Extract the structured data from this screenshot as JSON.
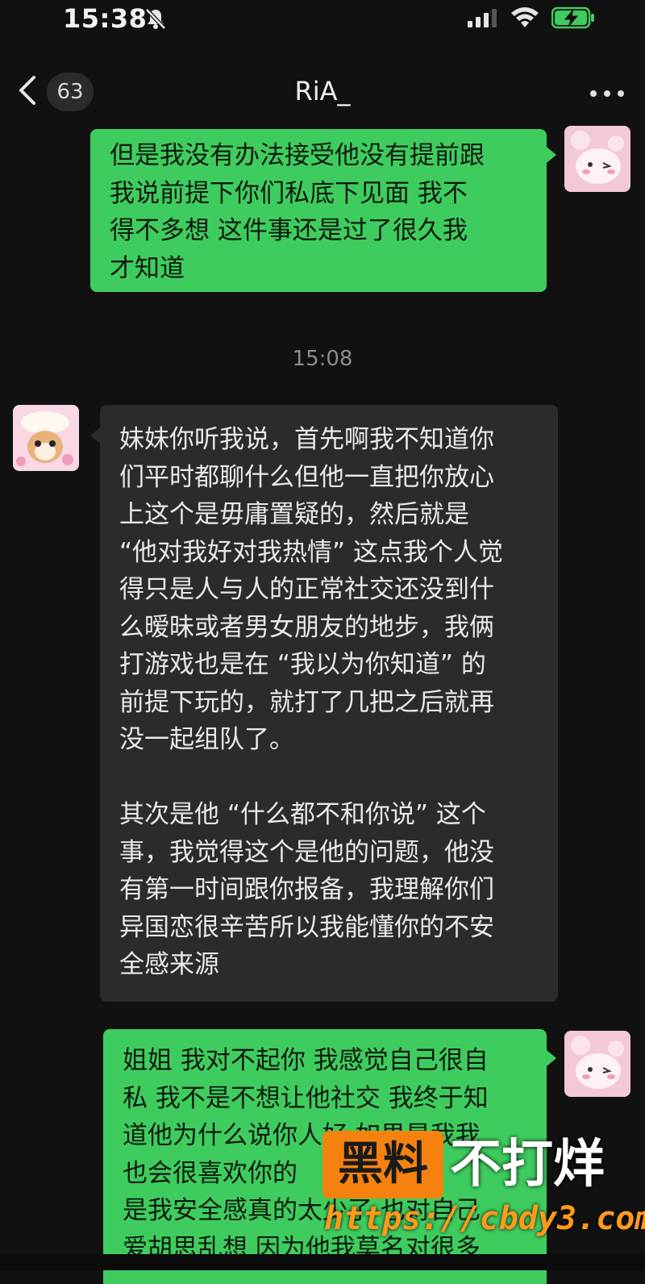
{
  "status_bar": {
    "time": "15:38"
  },
  "nav": {
    "unread_count": "63",
    "title": "RiA_"
  },
  "messages": [
    {
      "from": "me",
      "text": "但是我没有办法接受他没有提前跟\n我说前提下你们私底下见面 我不\n得不多想 这件事还是过了很久我\n才知道"
    },
    {
      "from": "other",
      "text": "妹妹你听我说，首先啊我不知道你\n们平时都聊什么但他一直把你放心\n上这个是毋庸置疑的，然后就是\n“他对我好对我热情” 这点我个人觉\n得只是人与人的正常社交还没到什\n么暧昧或者男女朋友的地步，我俩\n打游戏也是在 “我以为你知道” 的\n前提下玩的，就打了几把之后就再\n没一起组队了。\n\n其次是他 “什么都不和你说” 这个\n事，我觉得这个是他的问题，他没\n有第一时间跟你报备，我理解你们\n异国恋很辛苦所以我能懂你的不安\n全感来源"
    },
    {
      "from": "me",
      "text": "姐姐 我对不起你 我感觉自己很自\n私 我不是不想让他社交 我终于知\n道他为什么说你人好 如果是我我\n也会很喜欢你的\n是我安全感真的太少了 也对自己\n爱胡思乱想 因为他我莫名对很多"
    }
  ],
  "timestamp": "15:08",
  "watermark": {
    "box_text": "黑料",
    "tag_text": "不打烊",
    "url": "https://cbdy3.com"
  },
  "colors": {
    "outgoing_bubble": "#3fcc5f",
    "incoming_bubble": "#2b2b2b",
    "background": "#111111",
    "watermark_orange": "#f5820f"
  },
  "icons": {
    "mute": "bell-slash-icon",
    "signal": "cell-signal-icon",
    "wifi": "wifi-icon",
    "battery": "battery-charging-icon",
    "back": "chevron-left-icon",
    "more": "more-dots-icon"
  }
}
